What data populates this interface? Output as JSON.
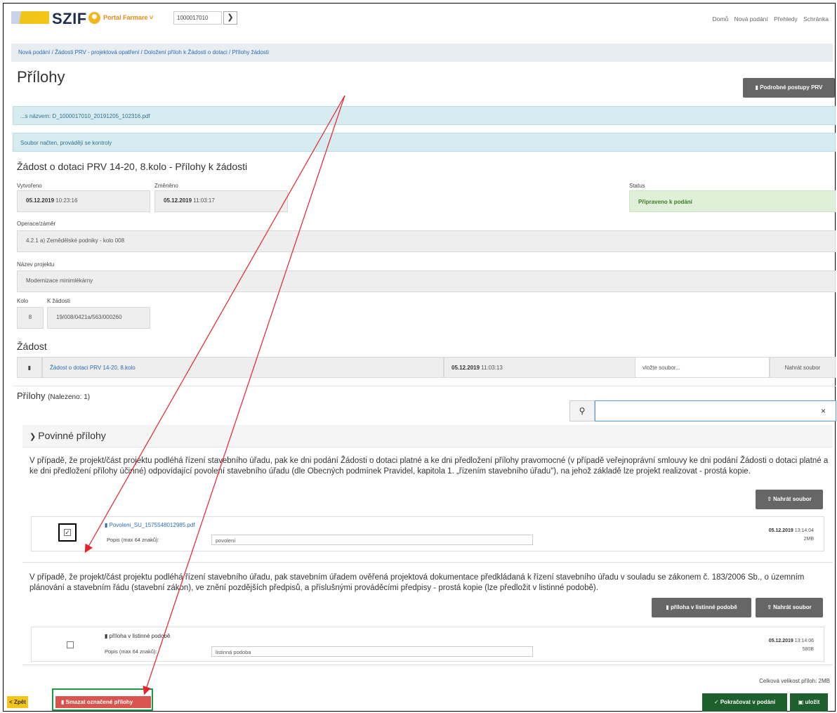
{
  "header": {
    "logo": "SZIF",
    "portal": "Portal Farmare ˅",
    "id_value": "1000017010",
    "go_icon": "chevron-right-icon",
    "nav": [
      "Domů",
      "Nová podání",
      "Přehledy",
      "Schránka"
    ]
  },
  "breadcrumb": "Nová podání / Žádosti PRV - projektová opatření / Doložení příloh k Žádosti o dotaci / Přílohy žádosti",
  "page_title": "Přílohy",
  "guide_button": "Podrobné postupy PRV",
  "alerts": [
    "...s názvem: D_1000017010_20191205_102316.pdf",
    "Soubor načten, provádějí se kontroly"
  ],
  "request": {
    "heading": "Žádost o dotaci PRV 14-20, 8.kolo - Přílohy k žádosti",
    "created_label": "Vytvořeno",
    "created_date": "05.12.2019",
    "created_time": "10:23:16",
    "changed_label": "Změněno",
    "changed_date": "05.12.2019",
    "changed_time": "11:03:17",
    "status_label": "Status",
    "status_value": "Připraveno k podání",
    "operation_label": "Operace/záměr",
    "operation_value": "4.2.1 a) Zemědělské podniky - kolo 008",
    "project_label": "Název projektu",
    "project_value": "Modernizace minimlékárny",
    "round_label": "Kolo",
    "round_value": "8",
    "ref_label": "K žádosti",
    "ref_value": "19/008/0421a/563/000260"
  },
  "zadost": {
    "heading": "Žádost",
    "doc_link": "Žádost o dotaci PRV 14-20, 8.kolo",
    "doc_date": "05.12.2019",
    "doc_time": "11:03:13",
    "file_placeholder": "vložte soubor...",
    "upload_label": "Nahrát soubor"
  },
  "prilohy": {
    "heading": "Přílohy",
    "count": "(Nalezeno: 1)",
    "search_value": "",
    "clear_icon": "×",
    "section": "Povinné přílohy",
    "items": [
      {
        "text": "V případě, že projekt/část projektu podléhá řízení stavebního úřadu, pak ke dni podání Žádosti o dotaci platné a ke dni předložení přílohy pravomocné (v případě veřejnoprávní smlouvy ke dni podání Žádosti o dotaci platné a ke dni předložení přílohy účinné) odpovídající povolení stavebního úřadu (dle Obecných podmínek Pravidel, kapitola 1. „řízením stavebního úřadu\"), na jehož základě lze projekt realizovat - prostá kopie.",
        "upload_label": "Nahrát soubor",
        "file_name": "Povoleni_SU_1575548012985.pdf",
        "desc_label": "Popis (max 64 znaků):",
        "desc_value": "povolení",
        "date": "05.12.2019",
        "time": "13:14:04",
        "size": "2MB",
        "checked": true
      },
      {
        "text": "V případě, že projekt/část projektu podléhá řízení stavebního úřadu, pak stavebním úřadem ověřená projektová dokumentace předkládaná k řízení stavebního úřadu v souladu se zákonem č. 183/2006 Sb., o územním plánování a stavebním řádu (stavební zákon), ve znění pozdějších předpisů, a příslušnými prováděcími předpisy - prostá kopie (lze předložit v listinné podobě).",
        "paper_label": "příloha v listinné podobě",
        "upload_label": "Nahrát soubor",
        "file_name": "příloha v listinné podobě",
        "desc_label": "Popis (max 64 znaků):",
        "desc_value": "listinná podoba",
        "date": "05.12.2019",
        "time": "13:14:06",
        "size": "580B",
        "checked": false
      }
    ],
    "total": "Celková velikost příloh: 2MB"
  },
  "footer": {
    "back": "< Zpět",
    "delete": "Smazat označené přílohy",
    "continue": "Pokračovat v podání",
    "save": "uložit"
  },
  "colors": {
    "annotation_arrow": "#e8212a",
    "annotation_green": "#1f9a43",
    "status_green": "#dff0d8",
    "alert_blue": "#d6ecf1"
  }
}
